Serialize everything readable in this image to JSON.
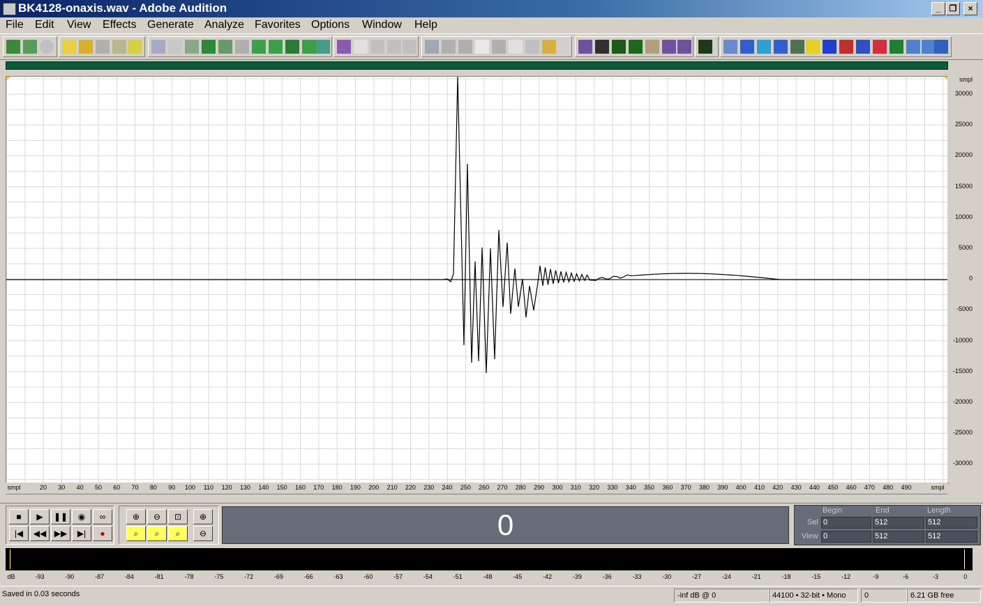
{
  "window": {
    "title": "BK4128-onaxis.wav - Adobe Audition"
  },
  "menu": [
    "File",
    "Edit",
    "View",
    "Effects",
    "Generate",
    "Analyze",
    "Favorites",
    "Options",
    "Window",
    "Help"
  ],
  "waveform": {
    "y_unit": "smpl",
    "y_ticks": [
      "30000",
      "25000",
      "20000",
      "15000",
      "10000",
      "5000",
      "0",
      "-5000",
      "-10000",
      "-15000",
      "-20000",
      "-25000",
      "-30000"
    ],
    "x_unit": "smpl",
    "x_ticks": [
      "20",
      "30",
      "40",
      "50",
      "60",
      "70",
      "80",
      "90",
      "100",
      "110",
      "120",
      "130",
      "140",
      "150",
      "160",
      "170",
      "180",
      "190",
      "200",
      "210",
      "220",
      "230",
      "240",
      "250",
      "260",
      "270",
      "280",
      "290",
      "300",
      "310",
      "320",
      "330",
      "340",
      "350",
      "360",
      "370",
      "380",
      "390",
      "400",
      "410",
      "420",
      "430",
      "440",
      "450",
      "460",
      "470",
      "480",
      "490"
    ],
    "colors": {
      "background": "#ffffff",
      "grid": "#d8d8d8",
      "line": "#000000"
    }
  },
  "transport": {
    "time": "0",
    "sel_label": "Sel",
    "view_label": "View",
    "begin_label": "Begin",
    "end_label": "End",
    "length_label": "Length",
    "sel": {
      "begin": "0",
      "end": "512",
      "length": "512"
    },
    "view": {
      "begin": "0",
      "end": "512",
      "length": "512"
    }
  },
  "meter": {
    "unit": "dB",
    "ticks": [
      "-93",
      "-90",
      "-87",
      "-84",
      "-81",
      "-78",
      "-75",
      "-72",
      "-69",
      "-66",
      "-63",
      "-60",
      "-57",
      "-54",
      "-51",
      "-48",
      "-45",
      "-42",
      "-39",
      "-36",
      "-33",
      "-30",
      "-27",
      "-24",
      "-21",
      "-18",
      "-15",
      "-12",
      "-9",
      "-6",
      "-3",
      "0"
    ]
  },
  "status": {
    "message": "Saved in 0.03 seconds",
    "level": "-inf dB @ 0",
    "format": "44100 • 32-bit • Mono",
    "value": "0",
    "free": "6.21 GB free"
  }
}
